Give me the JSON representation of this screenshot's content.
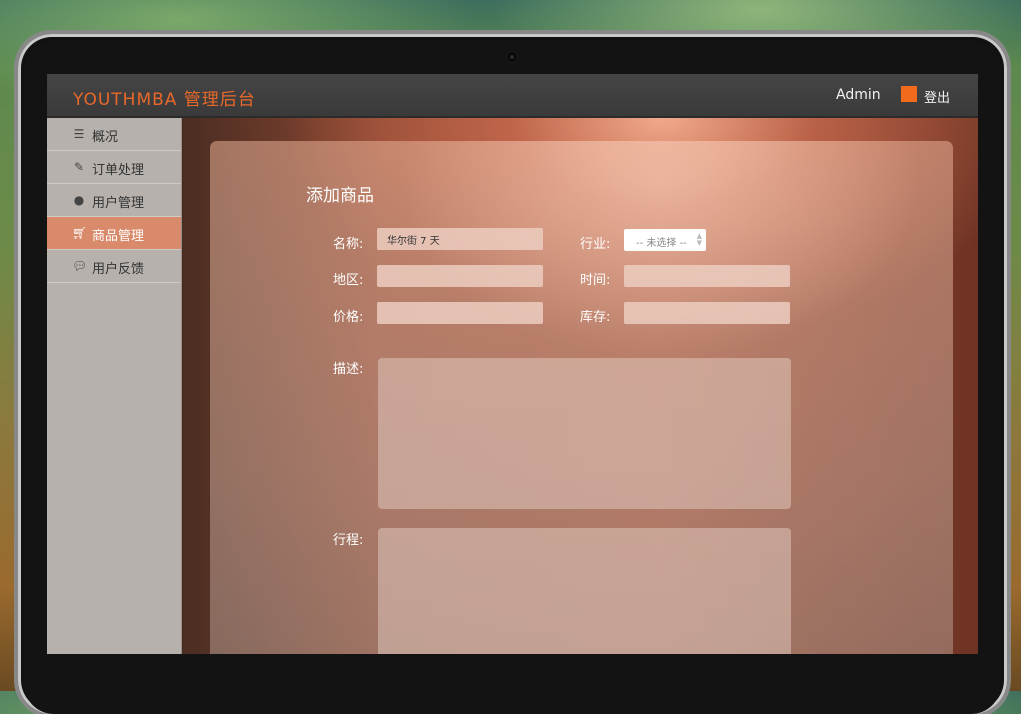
{
  "header": {
    "brand": "YOUTHMBA 管理后台",
    "user": "Admin",
    "logout_label": "登出",
    "accent_color": "#f26a1b"
  },
  "sidebar": {
    "items": [
      {
        "label": "概况",
        "icon": "list-icon"
      },
      {
        "label": "订单处理",
        "icon": "edit-icon"
      },
      {
        "label": "用户管理",
        "icon": "user-icon"
      },
      {
        "label": "商品管理",
        "icon": "cart-icon",
        "active": true
      },
      {
        "label": "用户反馈",
        "icon": "chat-bubble-icon"
      }
    ]
  },
  "form": {
    "title": "添加商品",
    "name_label": "名称:",
    "name_value": "华尔街 7 天",
    "industry_label": "行业:",
    "industry_value": "-- 未选择 --",
    "region_label": "地区:",
    "region_value": "",
    "time_label": "时间:",
    "time_value": "",
    "price_label": "价格:",
    "price_value": "",
    "stock_label": "库存:",
    "stock_value": "",
    "description_label": "描述:",
    "itinerary_label": "行程:"
  }
}
